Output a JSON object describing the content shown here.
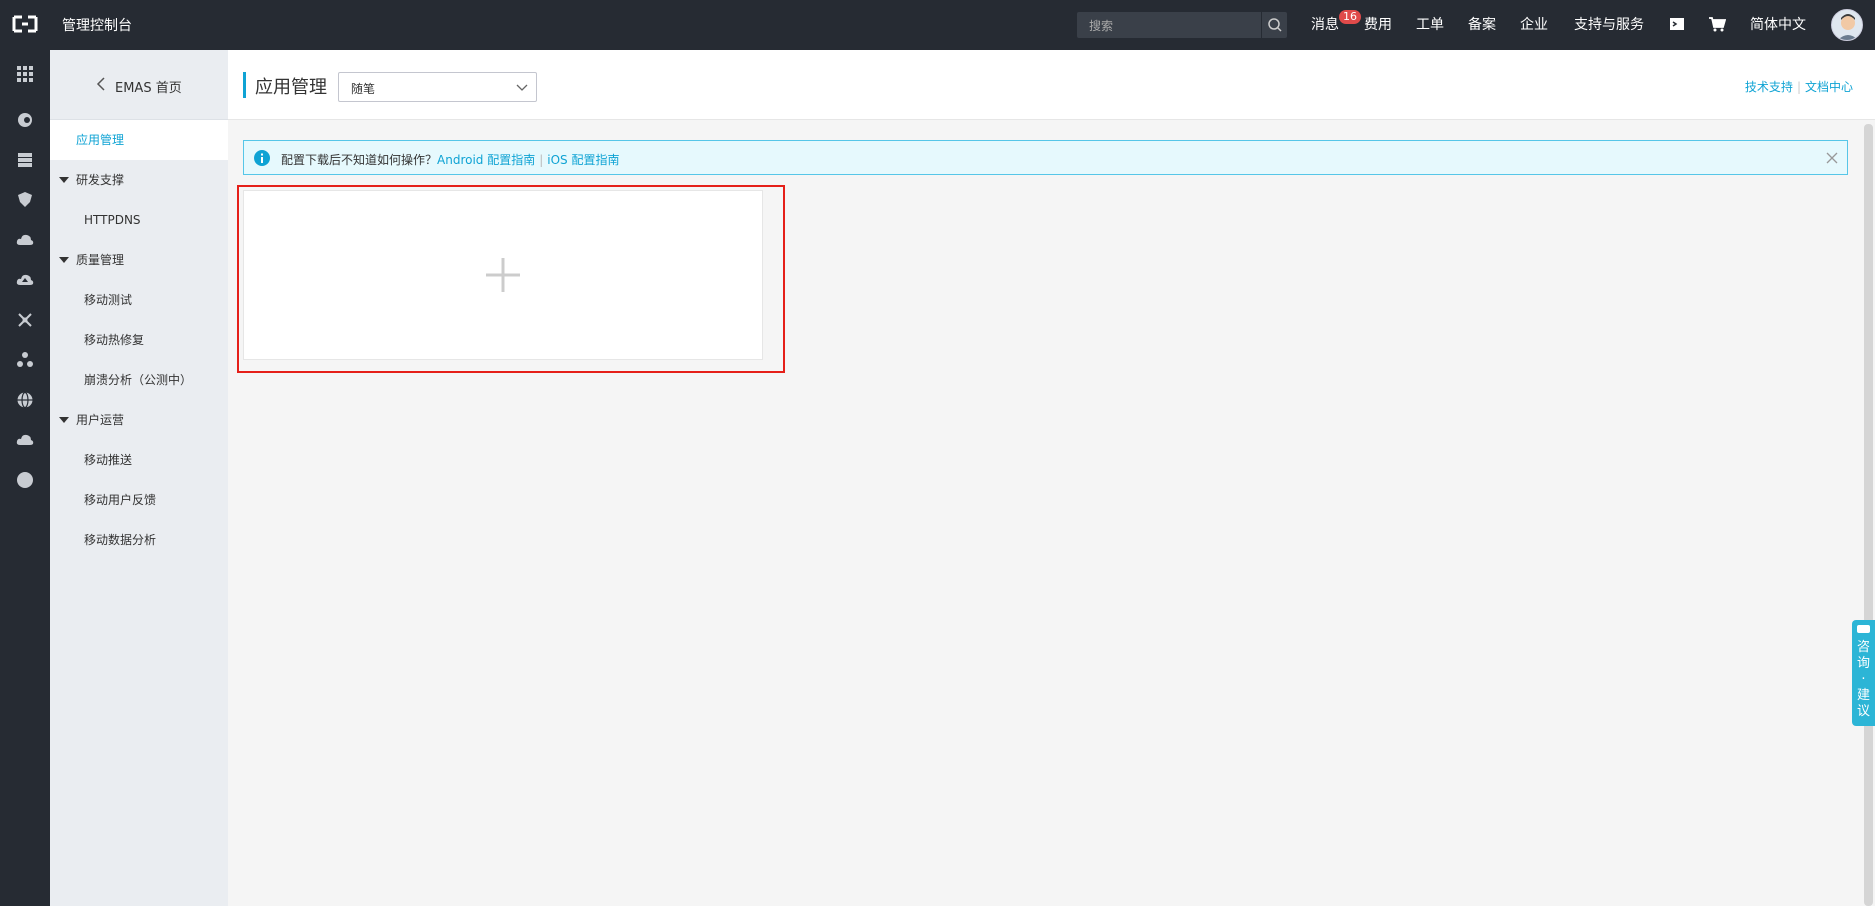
{
  "topbar": {
    "brand": "管理控制台",
    "search_placeholder": "搜索",
    "nav": {
      "messages": "消息",
      "messages_badge": "16",
      "billing": "费用",
      "tickets": "工单",
      "icp": "备案",
      "enterprise": "企业",
      "support": "支持与服务",
      "language": "简体中文"
    }
  },
  "sidebar": {
    "back_label": "EMAS 首页",
    "app_mgmt": "应用管理",
    "groups": {
      "dev": "研发支撑",
      "quality": "质量管理",
      "ops": "用户运营"
    },
    "items": {
      "httpdns": "HTTPDNS",
      "mobile_test": "移动测试",
      "hotfix": "移动热修复",
      "crash": "崩溃分析（公测中）",
      "push": "移动推送",
      "feedback": "移动用户反馈",
      "analytics": "移动数据分析"
    }
  },
  "header": {
    "title": "应用管理",
    "select_value": "随笔",
    "link_support": "技术支持",
    "link_docs": "文档中心"
  },
  "alert": {
    "text": "配置下载后不知道如何操作？",
    "android_link": "Android 配置指南",
    "ios_link": "iOS 配置指南"
  },
  "feedback_tab": {
    "label": "咨询·建议"
  },
  "colors": {
    "topbar": "#262b33",
    "accent": "#0fa3d4",
    "highlight": "#e52019"
  }
}
